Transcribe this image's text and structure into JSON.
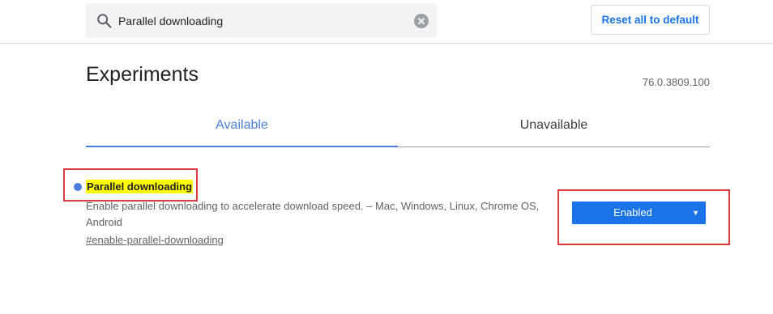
{
  "header": {
    "search": {
      "value": "Parallel downloading",
      "search_icon": "search-icon",
      "clear_icon": "clear-icon"
    },
    "reset_button_label": "Reset all to default"
  },
  "page": {
    "title": "Experiments",
    "version": "76.0.3809.100"
  },
  "tabs": [
    {
      "label": "Available",
      "active": true
    },
    {
      "label": "Unavailable",
      "active": false
    }
  ],
  "flag": {
    "title": "Parallel downloading",
    "description": "Enable parallel downloading to accelerate download speed. – Mac, Windows, Linux, Chrome OS, Android",
    "permalink": "#enable-parallel-downloading",
    "select_value": "Enabled",
    "select_arrow_icon": "dropdown-arrow-icon"
  },
  "colors": {
    "accent": "#1a73e8",
    "tab_active": "#4c7ee0",
    "highlight": "#ffff00",
    "annotation": "#e0393e"
  }
}
